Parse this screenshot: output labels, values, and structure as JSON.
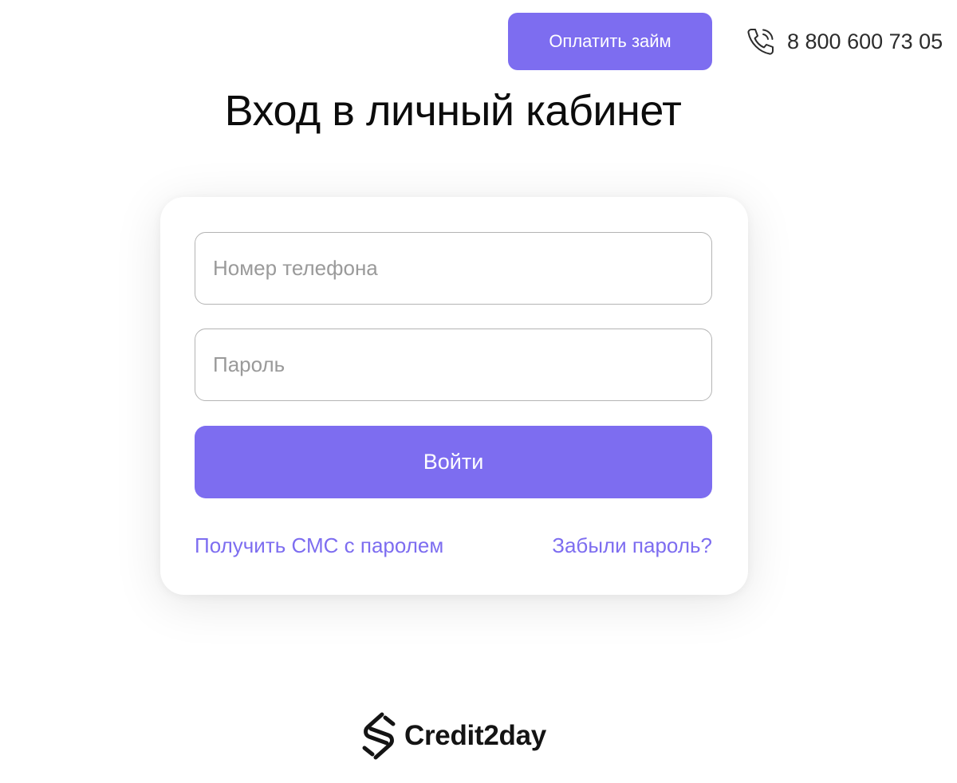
{
  "header": {
    "pay_button_label": "Оплатить займ",
    "phone_icon": "phone-icon",
    "phone_number": "8 800 600 73 05"
  },
  "page": {
    "title": "Вход в личный кабинет"
  },
  "login_form": {
    "phone_placeholder": "Номер телефона",
    "password_placeholder": "Пароль",
    "submit_label": "Войти",
    "sms_link_label": "Получить СМС с паролем",
    "forgot_link_label": "Забыли пароль?"
  },
  "footer": {
    "brand_icon": "brand-logo-icon",
    "brand_name": "Credit2day"
  },
  "colors": {
    "accent": "#7d6df0",
    "background": "#ffffff",
    "title_text": "#0c0c0c",
    "placeholder_text": "#9a9a9a",
    "field_border": "#b4b4b4"
  }
}
